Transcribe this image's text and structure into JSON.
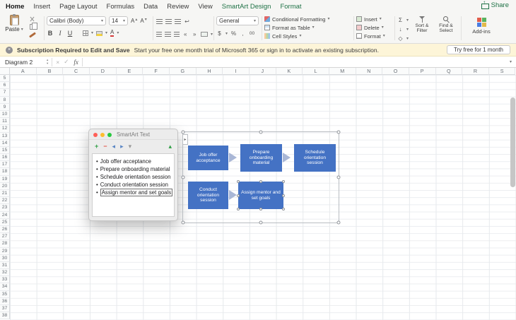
{
  "tabs": {
    "items": [
      {
        "label": "Home",
        "active": true,
        "contextual": false
      },
      {
        "label": "Insert",
        "active": false,
        "contextual": false
      },
      {
        "label": "Page Layout",
        "active": false,
        "contextual": false
      },
      {
        "label": "Formulas",
        "active": false,
        "contextual": false
      },
      {
        "label": "Data",
        "active": false,
        "contextual": false
      },
      {
        "label": "Review",
        "active": false,
        "contextual": false
      },
      {
        "label": "View",
        "active": false,
        "contextual": false
      },
      {
        "label": "SmartArt Design",
        "active": false,
        "contextual": true
      },
      {
        "label": "Format",
        "active": false,
        "contextual": true
      }
    ],
    "share_label": "Share"
  },
  "ribbon": {
    "paste_label": "Paste",
    "font_name": "Calibri (Body)",
    "font_size": "14",
    "number_format": "General",
    "styles": [
      "Conditional Formatting",
      "Format as Table",
      "Cell Styles"
    ],
    "cells": [
      "Insert",
      "Delete",
      "Format"
    ],
    "editing": [
      "Sort & Filter",
      "Find & Select"
    ],
    "addins_label": "Add-ins"
  },
  "notice": {
    "title": "Subscription Required to Edit and Save",
    "body": "Start your free one month trial of Microsoft 365 or sign in to activate an existing subscription.",
    "button": "Try free for 1 month"
  },
  "formula_bar": {
    "name_box": "Diagram 2",
    "fx_label": "fx"
  },
  "sheet": {
    "columns": [
      "A",
      "B",
      "C",
      "D",
      "E",
      "F",
      "G",
      "H",
      "I",
      "J",
      "K",
      "L",
      "M",
      "N",
      "O",
      "P",
      "Q",
      "R",
      "S"
    ],
    "first_row": 5,
    "last_row": 38
  },
  "smartart_pane": {
    "title": "SmartArt Text",
    "items": [
      "Job offer acceptance",
      "Prepare onboarding material",
      "Schedule orientation session",
      "Conduct orientation session",
      "Assign mentor and set goals"
    ],
    "selected_index": 4
  },
  "diagram": {
    "color": "#4472C4",
    "arrow_color": "#a9b7d6",
    "boxes": [
      {
        "label": "Job offer acceptance",
        "selected": false
      },
      {
        "label": "Prepare onboarding material",
        "selected": false
      },
      {
        "label": "Schedule orientation session",
        "selected": false
      },
      {
        "label": "Conduct orientation session",
        "selected": false
      },
      {
        "label": "Assign mentor and set goals",
        "selected": true
      }
    ]
  },
  "icons": {
    "caret_down": "▾",
    "cancel": "×",
    "enter": "✓",
    "sigma": "Σ",
    "percent": "%",
    "dollar": "$",
    "comma": ",",
    "zeros": "00",
    "bold": "B",
    "italic": "I",
    "underline": "U",
    "letter_a": "A",
    "up_small": "▴",
    "down_small": "▾",
    "wrap": "↩",
    "indent_left": "«",
    "indent_right": "»",
    "fill_down": "↓",
    "clear": "◇",
    "add": "+",
    "remove": "−",
    "promote": "◂",
    "demote": "▸",
    "move_up": "▴",
    "pane_toggle": "▸",
    "share_arrow": "↑"
  }
}
